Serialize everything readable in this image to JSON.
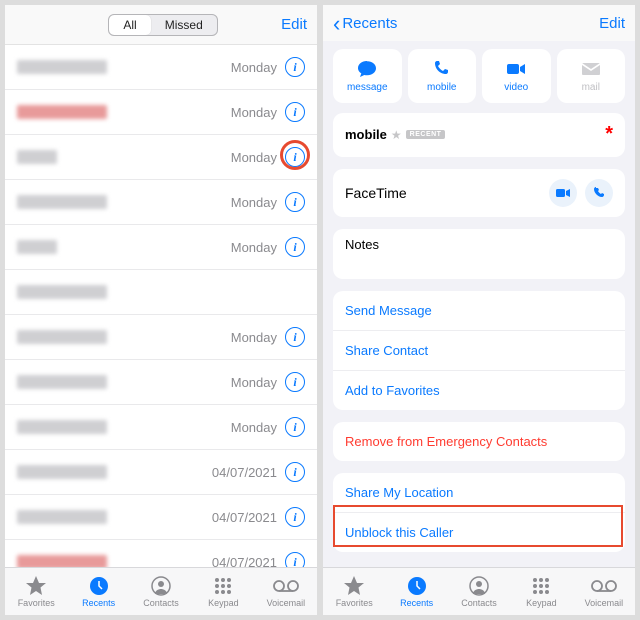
{
  "left": {
    "segmented": {
      "all": "All",
      "missed": "Missed"
    },
    "edit": "Edit",
    "rows": [
      {
        "time": "Monday",
        "red": false,
        "short": false
      },
      {
        "time": "Monday",
        "red": true,
        "short": false
      },
      {
        "time": "Monday",
        "red": false,
        "short": true
      },
      {
        "time": "Monday",
        "red": false,
        "short": false
      },
      {
        "time": "Monday",
        "red": false,
        "short": true
      },
      {
        "time": "",
        "red": false,
        "short": false
      },
      {
        "time": "Monday",
        "red": false,
        "short": false
      },
      {
        "time": "Monday",
        "red": false,
        "short": false
      },
      {
        "time": "Monday",
        "red": false,
        "short": false
      },
      {
        "time": "04/07/2021",
        "red": false,
        "short": false
      },
      {
        "time": "04/07/2021",
        "red": false,
        "short": false
      },
      {
        "time": "04/07/2021",
        "red": true,
        "short": false
      }
    ],
    "info_glyph": "i"
  },
  "right": {
    "back": "Recents",
    "edit": "Edit",
    "actions": {
      "message": "message",
      "mobile": "mobile",
      "video": "video",
      "mail": "mail"
    },
    "mobile": {
      "label": "mobile",
      "badge": "RECENT"
    },
    "facetime": "FaceTime",
    "notes": "Notes",
    "links1": [
      "Send Message",
      "Share Contact",
      "Add to Favorites"
    ],
    "danger": "Remove from Emergency Contacts",
    "links2": [
      "Share My Location",
      "Unblock this Caller"
    ]
  },
  "tabs": {
    "favorites": "Favorites",
    "recents": "Recents",
    "contacts": "Contacts",
    "keypad": "Keypad",
    "voicemail": "Voicemail"
  }
}
